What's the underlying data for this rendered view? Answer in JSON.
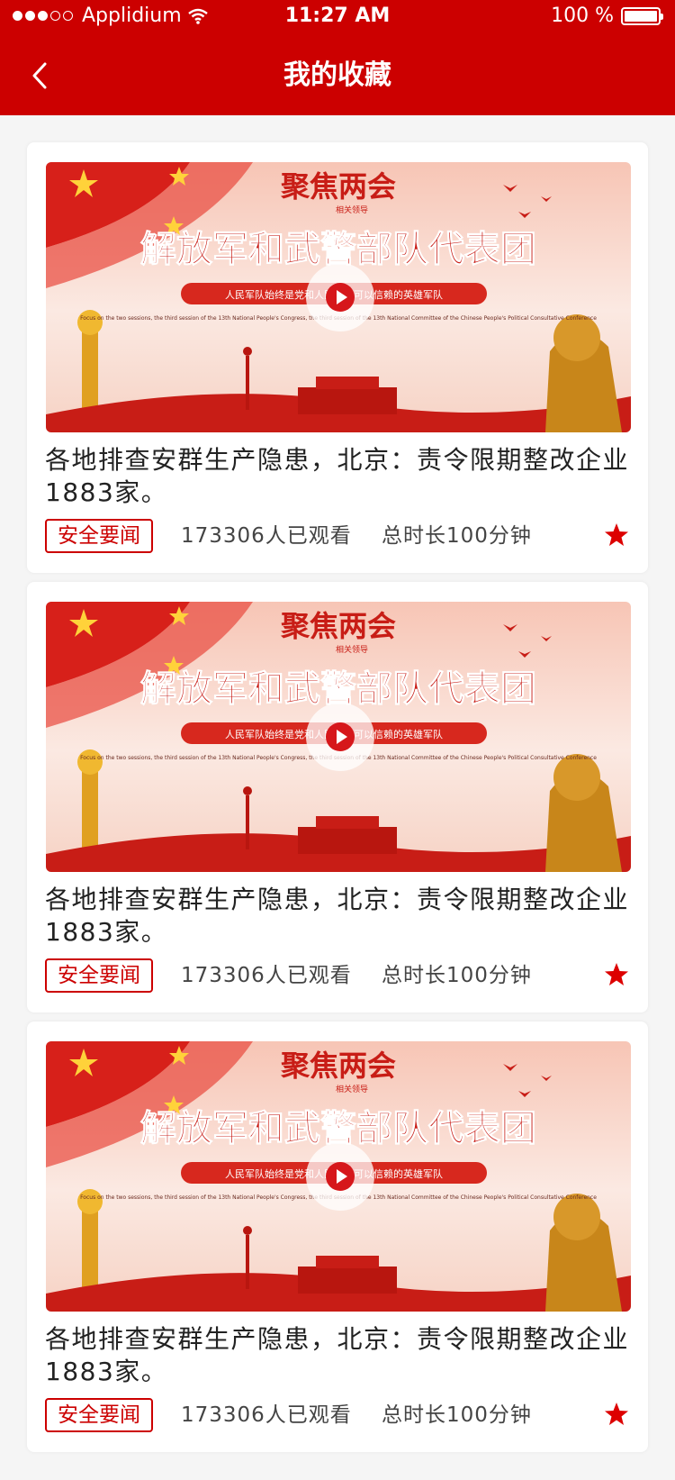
{
  "status_bar": {
    "carrier": "Applidium",
    "time": "11:27 AM",
    "battery": "100 %"
  },
  "header": {
    "title": "我的收藏",
    "back_icon": "chevron-left-icon"
  },
  "thumbnail_text": {
    "headline": "聚焦两会",
    "subhead": "相关领导",
    "main": "解放军和武警部队代表团",
    "banner": "人民军队始终是党和人民完全可以信赖的英雄军队",
    "english": "Focus on the two sessions, the third session of the 13th National People's Congress, the third session of the 13th National Committee of the Chinese People's Political Consultative Conference"
  },
  "items": [
    {
      "title": "各地排查安群生产隐患，北京：责令限期整改企业1883家。",
      "tag": "安全要闻",
      "views": "173306人已观看",
      "duration": "总时长100分钟",
      "favorited": true
    },
    {
      "title": "各地排查安群生产隐患，北京：责令限期整改企业1883家。",
      "tag": "安全要闻",
      "views": "173306人已观看",
      "duration": "总时长100分钟",
      "favorited": true
    },
    {
      "title": "各地排查安群生产隐患，北京：责令限期整改企业1883家。",
      "tag": "安全要闻",
      "views": "173306人已观看",
      "duration": "总时长100分钟",
      "favorited": true
    }
  ],
  "colors": {
    "brand_red": "#cc0000",
    "star": "#dd0000"
  }
}
